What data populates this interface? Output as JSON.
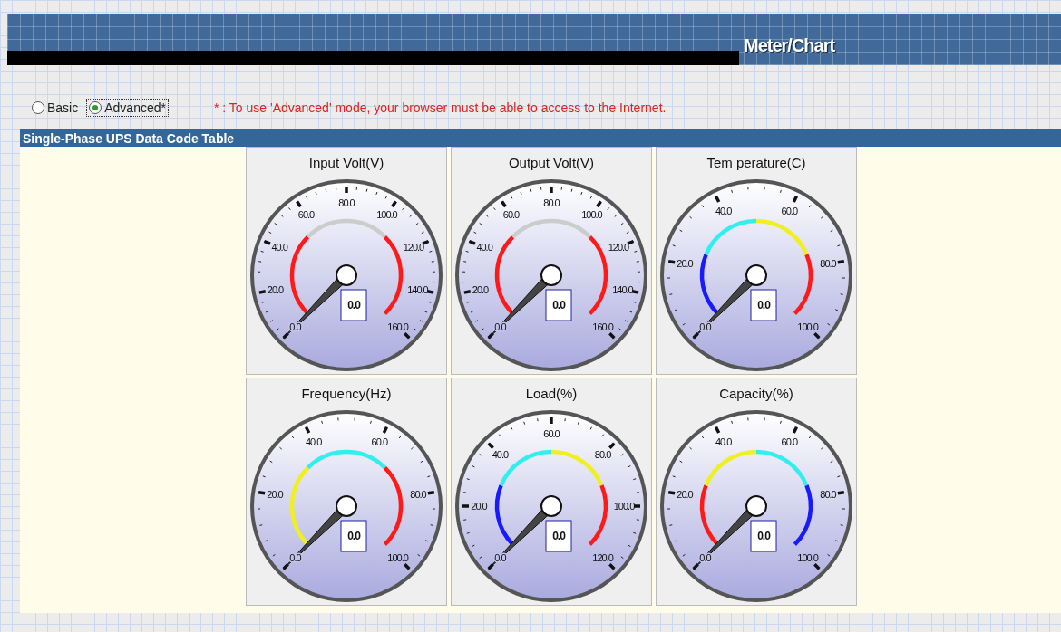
{
  "header": {
    "title": "Meter/Chart"
  },
  "mode_options": [
    {
      "label": "Basic",
      "selected": false,
      "focused": false
    },
    {
      "label": "Advanced*",
      "selected": true,
      "focused": true
    }
  ],
  "mode_note": "* : To use 'Advanced' mode, your browser must be able to access to the Internet.",
  "section": {
    "title": "Single-Phase UPS Data Code Table"
  },
  "gauges": [
    {
      "title": "Input Volt(V)",
      "ticks": [
        "0.0",
        "20.0",
        "40.0",
        "60.0",
        "80.0",
        "100.0",
        "120.0",
        "140.0",
        "160.0"
      ],
      "reading": "0.0",
      "bands": [
        {
          "color": "#ff1a1a"
        },
        {
          "color": "#cccccc"
        },
        {
          "color": "#ff1a1a"
        }
      ]
    },
    {
      "title": "Output Volt(V)",
      "ticks": [
        "0.0",
        "20.0",
        "40.0",
        "60.0",
        "80.0",
        "100.0",
        "120.0",
        "140.0",
        "160.0"
      ],
      "reading": "0.0",
      "bands": [
        {
          "color": "#ff1a1a"
        },
        {
          "color": "#cccccc"
        },
        {
          "color": "#ff1a1a"
        }
      ]
    },
    {
      "title": "Tem perature(C)",
      "ticks": [
        "0.0",
        "20.0",
        "40.0",
        "60.0",
        "80.0",
        "100.0"
      ],
      "reading": "0.0",
      "bands": [
        {
          "color": "#1a1aff"
        },
        {
          "color": "#33eeee"
        },
        {
          "color": "#f0f020"
        },
        {
          "color": "#ff1a1a"
        }
      ]
    },
    {
      "title": "Frequency(Hz)",
      "ticks": [
        "0.0",
        "20.0",
        "40.0",
        "60.0",
        "80.0",
        "100.0"
      ],
      "reading": "0.0",
      "bands": [
        {
          "color": "#f0f020"
        },
        {
          "color": "#33eeee"
        },
        {
          "color": "#ff1a1a"
        }
      ]
    },
    {
      "title": "Load(%)",
      "ticks": [
        "0.0",
        "20.0",
        "40.0",
        "60.0",
        "80.0",
        "100.0",
        "120.0"
      ],
      "reading": "0.0",
      "bands": [
        {
          "color": "#1a1aff"
        },
        {
          "color": "#33eeee"
        },
        {
          "color": "#f0f020"
        },
        {
          "color": "#ff1a1a"
        }
      ]
    },
    {
      "title": "Capacity(%)",
      "ticks": [
        "0.0",
        "20.0",
        "40.0",
        "60.0",
        "80.0",
        "100.0"
      ],
      "reading": "0.0",
      "bands": [
        {
          "color": "#ff1a1a"
        },
        {
          "color": "#f0f020"
        },
        {
          "color": "#33eeee"
        },
        {
          "color": "#1a1aff"
        }
      ]
    }
  ]
}
